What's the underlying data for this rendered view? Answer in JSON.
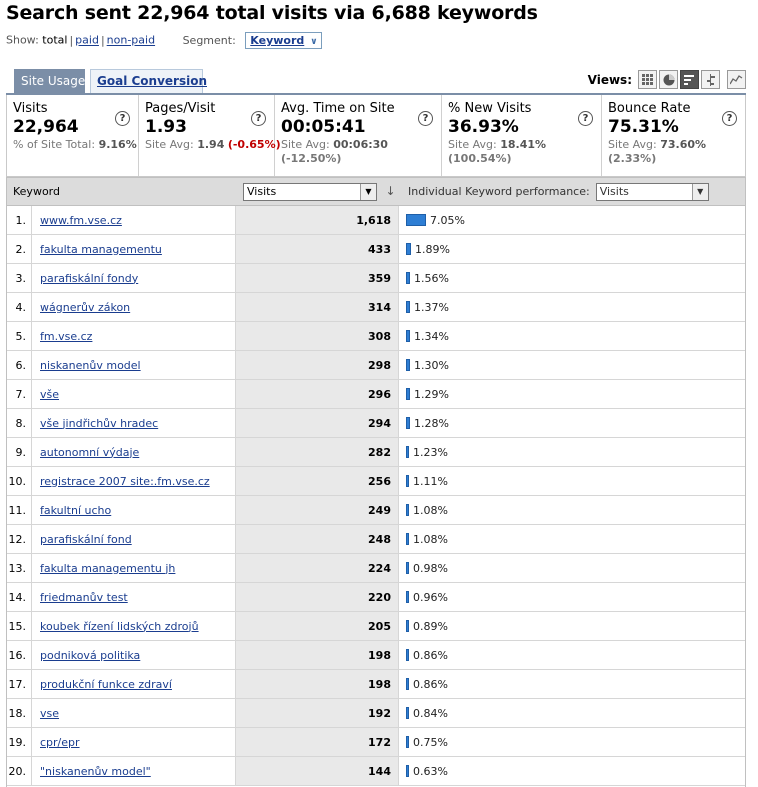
{
  "page": {
    "title": "Search sent 22,964 total visits via 6,688 keywords"
  },
  "show_filter": {
    "label": "Show:",
    "total": "total",
    "paid": "paid",
    "non_paid": "non-paid",
    "separator": "|"
  },
  "segment": {
    "label": "Segment:",
    "value": "Keyword"
  },
  "tabs": [
    {
      "label": "Site Usage",
      "active": true
    },
    {
      "label": "Goal Conversion",
      "active": false
    }
  ],
  "views": {
    "label": "Views:",
    "buttons": [
      {
        "icon": "table-view-icon",
        "active": false
      },
      {
        "icon": "pie-view-icon",
        "active": false
      },
      {
        "icon": "performance-view-icon",
        "active": true
      },
      {
        "icon": "comparison-view-icon",
        "active": false
      },
      {
        "icon": "pivot-chart-view-icon",
        "active": false
      }
    ]
  },
  "metrics": [
    {
      "label": "Visits",
      "value": "22,964",
      "sub_prefix": "% of Site Total:",
      "sub_value": "9.16%",
      "delta": ""
    },
    {
      "label": "Pages/Visit",
      "value": "1.93",
      "sub_prefix": "Site Avg:",
      "sub_value": "1.94",
      "delta": "(-0.65%)"
    },
    {
      "label": "Avg. Time on Site",
      "value": "00:05:41",
      "sub_prefix": "Site Avg:",
      "sub_value": "00:06:30",
      "delta": "(-12.50%)"
    },
    {
      "label": "% New Visits",
      "value": "36.93%",
      "sub_prefix": "Site Avg:",
      "sub_value": "18.41%",
      "delta": "(100.54%)"
    },
    {
      "label": "Bounce Rate",
      "value": "75.31%",
      "sub_prefix": "Site Avg:",
      "sub_value": "73.60%",
      "delta": "(2.33%)"
    }
  ],
  "metric_help": "?",
  "table": {
    "col_keyword": "Keyword",
    "col_metric": "Visits",
    "perf_label": "Individual Keyword performance:",
    "perf_metric": "Visits",
    "rows": [
      {
        "idx": "1.",
        "keyword": "www.fm.vse.cz",
        "visits": "1,618",
        "pct": "7.05%",
        "share": 7.05
      },
      {
        "idx": "2.",
        "keyword": "fakulta managementu",
        "visits": "433",
        "pct": "1.89%",
        "share": 1.89
      },
      {
        "idx": "3.",
        "keyword": "parafiskální fondy",
        "visits": "359",
        "pct": "1.56%",
        "share": 1.56
      },
      {
        "idx": "4.",
        "keyword": "wágnerův zákon",
        "visits": "314",
        "pct": "1.37%",
        "share": 1.37
      },
      {
        "idx": "5.",
        "keyword": "fm.vse.cz",
        "visits": "308",
        "pct": "1.34%",
        "share": 1.34
      },
      {
        "idx": "6.",
        "keyword": "niskanenův model",
        "visits": "298",
        "pct": "1.30%",
        "share": 1.3
      },
      {
        "idx": "7.",
        "keyword": "vše",
        "visits": "296",
        "pct": "1.29%",
        "share": 1.29
      },
      {
        "idx": "8.",
        "keyword": "vše jindřichův hradec",
        "visits": "294",
        "pct": "1.28%",
        "share": 1.28
      },
      {
        "idx": "9.",
        "keyword": "autonomní výdaje",
        "visits": "282",
        "pct": "1.23%",
        "share": 1.23
      },
      {
        "idx": "10.",
        "keyword": "registrace 2007 site:.fm.vse.cz",
        "visits": "256",
        "pct": "1.11%",
        "share": 1.11
      },
      {
        "idx": "11.",
        "keyword": "fakultní ucho",
        "visits": "249",
        "pct": "1.08%",
        "share": 1.08
      },
      {
        "idx": "12.",
        "keyword": "parafiskální fond",
        "visits": "248",
        "pct": "1.08%",
        "share": 1.08
      },
      {
        "idx": "13.",
        "keyword": "fakulta managementu jh",
        "visits": "224",
        "pct": "0.98%",
        "share": 0.98
      },
      {
        "idx": "14.",
        "keyword": "friedmanův test",
        "visits": "220",
        "pct": "0.96%",
        "share": 0.96
      },
      {
        "idx": "15.",
        "keyword": "koubek řízení lidských zdrojů",
        "visits": "205",
        "pct": "0.89%",
        "share": 0.89
      },
      {
        "idx": "16.",
        "keyword": "podniková politika",
        "visits": "198",
        "pct": "0.86%",
        "share": 0.86
      },
      {
        "idx": "17.",
        "keyword": "produkční funkce zdraví",
        "visits": "198",
        "pct": "0.86%",
        "share": 0.86
      },
      {
        "idx": "18.",
        "keyword": "vse",
        "visits": "192",
        "pct": "0.84%",
        "share": 0.84
      },
      {
        "idx": "19.",
        "keyword": "cpr/epr",
        "visits": "172",
        "pct": "0.75%",
        "share": 0.75
      },
      {
        "idx": "20.",
        "keyword": "\"niskanenův model\"",
        "visits": "144",
        "pct": "0.63%",
        "share": 0.63
      }
    ]
  },
  "colors": {
    "bar": "#2e7ed4",
    "link": "#1a3d8f",
    "negative": "#c00000",
    "positive": "#118811",
    "tab_active": "#7b8ea7"
  }
}
